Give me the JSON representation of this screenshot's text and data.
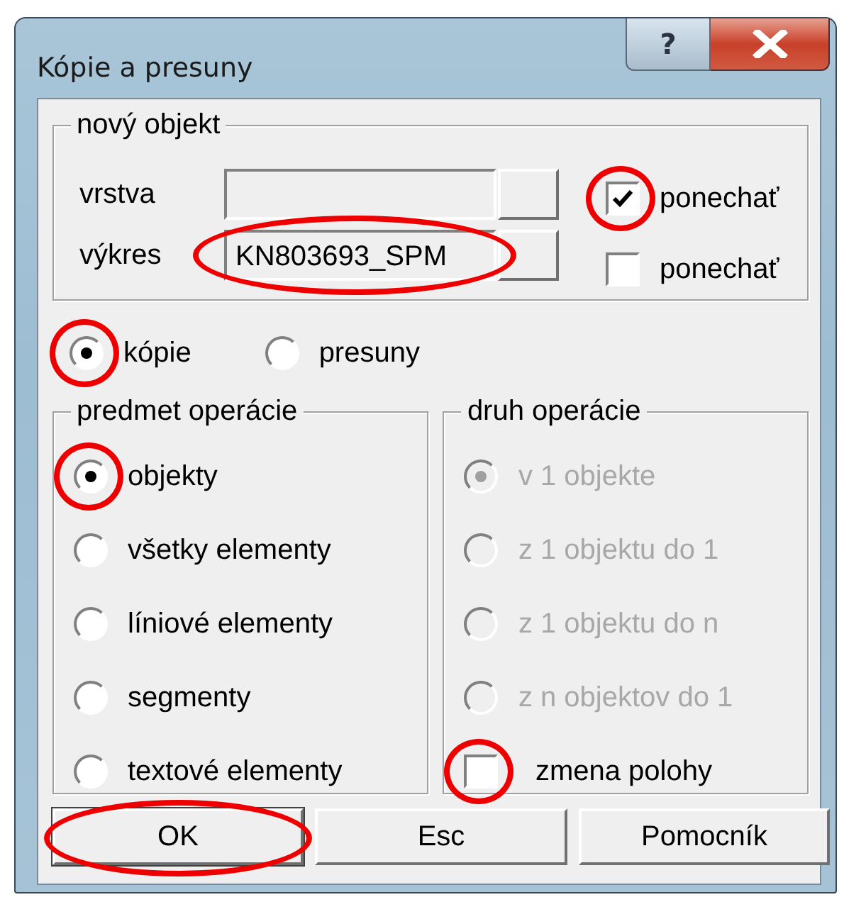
{
  "window": {
    "title": "Kópie a presuny",
    "help_label": "?"
  },
  "new_object": {
    "legend": "nový objekt",
    "fields": [
      {
        "label": "vrstva"
      },
      {
        "label": "výkres",
        "value": "KN803693_SPM",
        "circled": true
      }
    ],
    "checkboxes": [
      {
        "label": "ponechať",
        "checked": true,
        "circled": true
      },
      {
        "label": "ponechať",
        "checked": false
      }
    ]
  },
  "mode": [
    {
      "label": "kópie",
      "selected": true,
      "circled": true
    },
    {
      "label": "presuny",
      "selected": false
    }
  ],
  "subject": {
    "legend": "predmet operácie",
    "options": [
      {
        "label": "objekty",
        "selected": true,
        "circled": true
      },
      {
        "label": "všetky elementy",
        "selected": false
      },
      {
        "label": "líniové elementy",
        "selected": false
      },
      {
        "label": "segmenty",
        "selected": false
      },
      {
        "label": "textové elementy",
        "selected": false
      }
    ]
  },
  "operation": {
    "legend": "druh operácie",
    "options": [
      {
        "label": "v 1 objekte",
        "selected": true,
        "disabled": true
      },
      {
        "label": "z 1 objektu do 1",
        "selected": false,
        "disabled": true
      },
      {
        "label": "z 1 objektu do n",
        "selected": false,
        "disabled": true
      },
      {
        "label": "z n objektov do 1",
        "selected": false,
        "disabled": true
      }
    ],
    "checkbox": {
      "label": "zmena polohy",
      "checked": false,
      "circled": true
    }
  },
  "buttons": [
    {
      "label": "OK",
      "default": true,
      "circled": true
    },
    {
      "label": "Esc",
      "default": false
    },
    {
      "label": "Pomocník",
      "default": false
    }
  ]
}
